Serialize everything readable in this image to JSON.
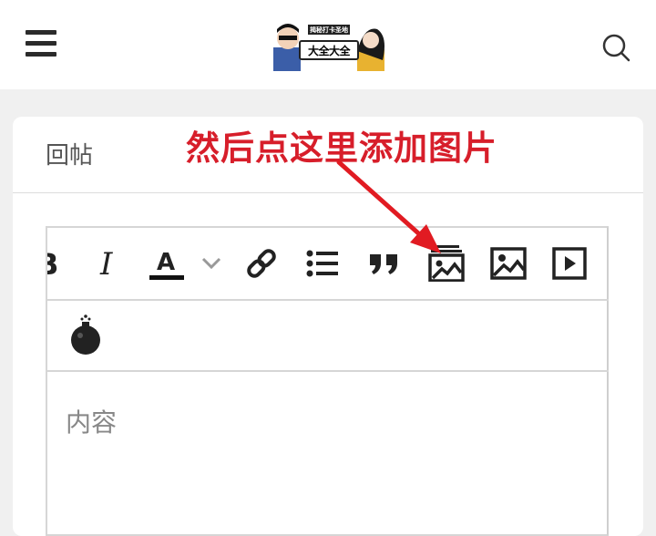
{
  "header": {
    "menu_icon": "hamburger-menu-icon",
    "logo_text": "大全大全",
    "logo_tag": "揭秘打卡圣地",
    "search_icon": "search-icon"
  },
  "card": {
    "title": "回帖"
  },
  "annotation": {
    "text": "然后点这里添加图片",
    "color": "#d71e2a"
  },
  "toolbar": {
    "row1": [
      {
        "name": "bold-icon",
        "glyph": "B"
      },
      {
        "name": "italic-icon",
        "glyph": "I"
      },
      {
        "name": "text-color-icon",
        "glyph": "A"
      },
      {
        "name": "chevron-down-icon"
      },
      {
        "name": "link-icon"
      },
      {
        "name": "bulleted-list-icon"
      },
      {
        "name": "quote-icon",
        "glyph": "❞"
      },
      {
        "name": "image-gallery-icon"
      },
      {
        "name": "image-icon"
      },
      {
        "name": "video-icon"
      }
    ],
    "row2": [
      {
        "name": "bomb-icon"
      }
    ]
  },
  "editor": {
    "placeholder": "内容"
  }
}
